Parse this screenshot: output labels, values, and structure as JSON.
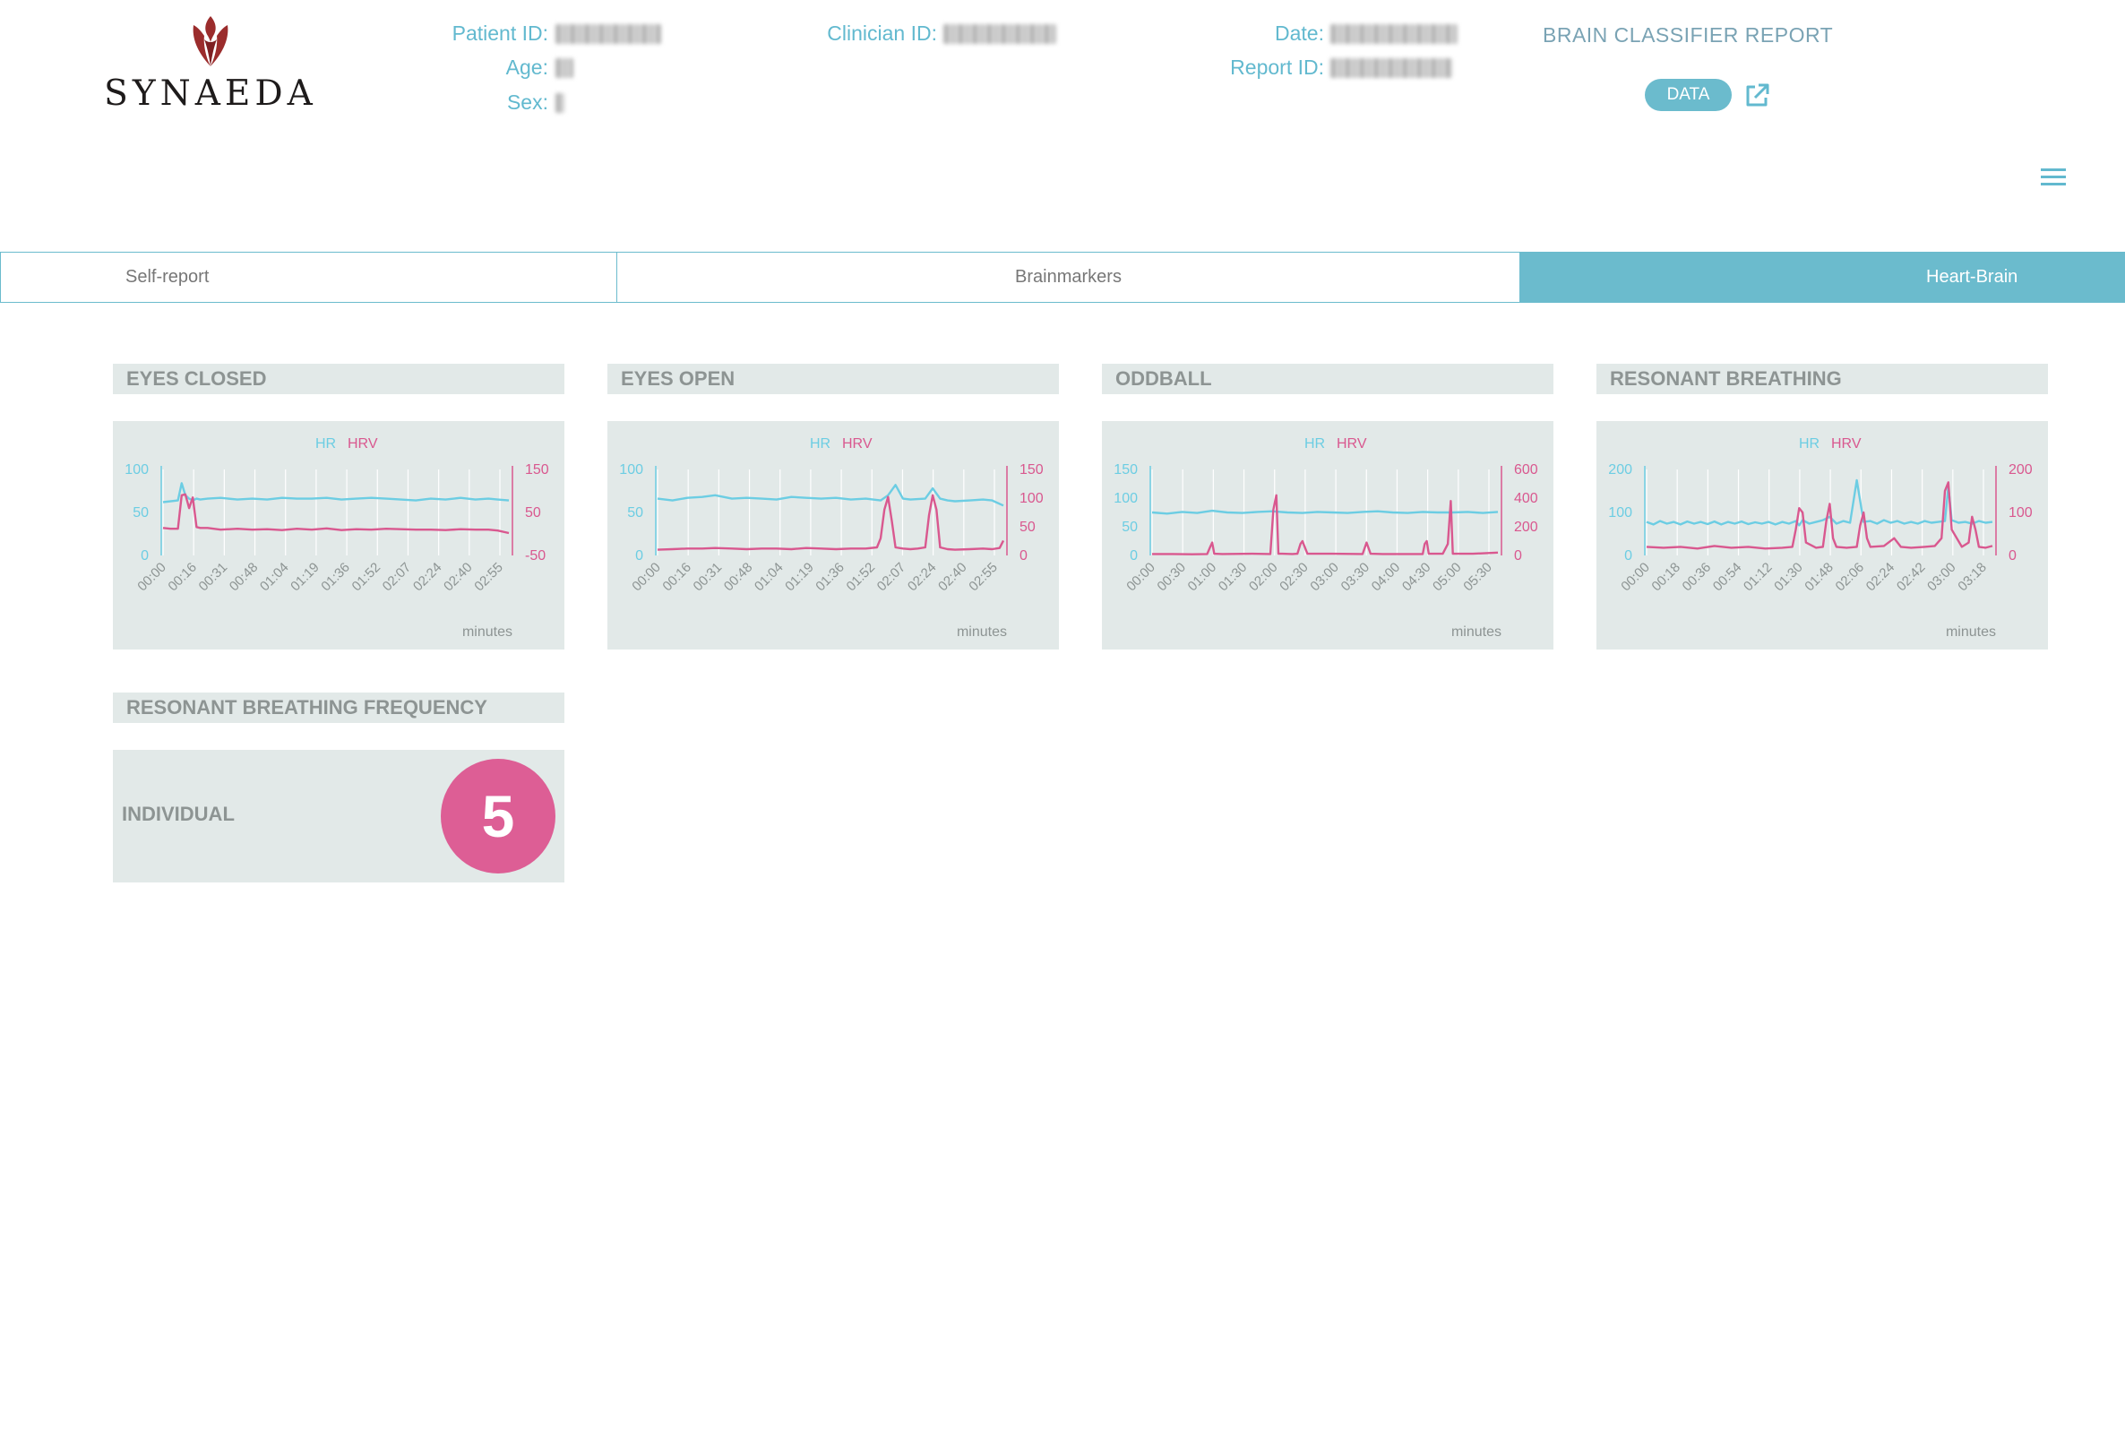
{
  "header": {
    "brand": "SYNAEDA",
    "patient_id_label": "Patient ID:",
    "age_label": "Age:",
    "sex_label": "Sex:",
    "clinician_id_label": "Clinician ID:",
    "date_label": "Date:",
    "report_id_label": "Report ID:",
    "report_title": "BRAIN CLASSIFIER REPORT",
    "data_button": "DATA"
  },
  "icons": {
    "logo": "tulip-icon",
    "external": "external-link-icon",
    "menu": "hamburger-menu-icon"
  },
  "colors": {
    "accent": "#6bbbcd",
    "hr": "#6ccde3",
    "hrv": "#d9588f",
    "panel_bg": "#e2e9e8",
    "frequency_badge": "#dd5e95",
    "brand": "#9b2c2c"
  },
  "tabs": [
    {
      "label": "Self-report",
      "active": false
    },
    {
      "label": "Brainmarkers",
      "active": false
    },
    {
      "label": "Heart-Brain",
      "active": true
    }
  ],
  "panels": [
    {
      "title": "EYES CLOSED"
    },
    {
      "title": "EYES OPEN"
    },
    {
      "title": "ODDBALL"
    },
    {
      "title": "RESONANT BREATHING"
    }
  ],
  "chart_data": [
    {
      "type": "line",
      "title": "EYES CLOSED",
      "xlabel": "minutes",
      "legend": [
        "HR",
        "HRV"
      ],
      "x_ticks": [
        "00:00",
        "00:16",
        "00:31",
        "00:48",
        "01:04",
        "01:19",
        "01:36",
        "01:52",
        "02:07",
        "02:24",
        "02:40",
        "02:55"
      ],
      "y_left_ticks": [
        "100",
        "50",
        "0"
      ],
      "y_right_ticks": [
        "150",
        "50",
        "-50"
      ],
      "y_left_range": [
        0,
        100
      ],
      "y_right_range": [
        -50,
        150
      ],
      "series": [
        {
          "name": "HR",
          "axis": "left",
          "x": [
            0,
            8,
            10,
            12,
            14,
            16,
            18,
            20,
            24,
            31,
            40,
            48,
            56,
            64,
            72,
            80,
            88,
            96,
            104,
            112,
            120,
            128,
            136,
            144,
            152,
            160,
            168,
            175,
            180,
            186
          ],
          "values": [
            62,
            64,
            84,
            70,
            66,
            64,
            66,
            65,
            66,
            67,
            65,
            66,
            65,
            67,
            66,
            66,
            67,
            65,
            66,
            67,
            66,
            65,
            64,
            66,
            65,
            67,
            65,
            66,
            65,
            64
          ]
        },
        {
          "name": "HRV",
          "axis": "right",
          "x": [
            0,
            4,
            8,
            10,
            12,
            14,
            16,
            18,
            20,
            24,
            31,
            40,
            48,
            56,
            64,
            72,
            80,
            88,
            96,
            104,
            112,
            120,
            128,
            136,
            144,
            152,
            160,
            168,
            175,
            180,
            186
          ],
          "values": [
            14,
            12,
            12,
            90,
            92,
            60,
            85,
            16,
            14,
            14,
            10,
            12,
            10,
            11,
            9,
            12,
            10,
            13,
            9,
            11,
            10,
            12,
            11,
            10,
            10,
            9,
            11,
            10,
            10,
            8,
            2
          ]
        }
      ]
    },
    {
      "type": "line",
      "title": "EYES OPEN",
      "xlabel": "minutes",
      "legend": [
        "HR",
        "HRV"
      ],
      "x_ticks": [
        "00:00",
        "00:16",
        "00:31",
        "00:48",
        "01:04",
        "01:19",
        "01:36",
        "01:52",
        "02:07",
        "02:24",
        "02:40",
        "02:55"
      ],
      "y_left_ticks": [
        "100",
        "50",
        "0"
      ],
      "y_right_ticks": [
        "150",
        "100",
        "50",
        "0"
      ],
      "y_left_range": [
        0,
        100
      ],
      "y_right_range": [
        0,
        150
      ],
      "series": [
        {
          "name": "HR",
          "axis": "left",
          "x": [
            0,
            8,
            16,
            24,
            31,
            40,
            48,
            56,
            64,
            72,
            80,
            88,
            96,
            104,
            112,
            120,
            124,
            128,
            132,
            136,
            144,
            148,
            152,
            156,
            160,
            168,
            175,
            180,
            186
          ],
          "values": [
            66,
            64,
            67,
            68,
            70,
            66,
            67,
            66,
            65,
            68,
            67,
            66,
            67,
            65,
            66,
            64,
            70,
            82,
            66,
            65,
            66,
            78,
            66,
            64,
            63,
            64,
            65,
            64,
            58
          ]
        },
        {
          "name": "HRV",
          "axis": "left_scaled",
          "axis_note": "right",
          "x": [
            0,
            8,
            16,
            24,
            31,
            40,
            48,
            56,
            64,
            72,
            80,
            88,
            96,
            104,
            112,
            118,
            120,
            122,
            124,
            126,
            128,
            132,
            136,
            140,
            144,
            146,
            148,
            150,
            152,
            156,
            160,
            168,
            175,
            180,
            184,
            186
          ],
          "values": [
            10,
            11,
            12,
            12,
            13,
            12,
            11,
            12,
            12,
            11,
            13,
            12,
            11,
            12,
            12,
            14,
            30,
            80,
            102,
            60,
            14,
            12,
            11,
            12,
            14,
            70,
            105,
            80,
            14,
            11,
            10,
            11,
            12,
            11,
            13,
            26
          ]
        }
      ]
    },
    {
      "type": "line",
      "title": "ODDBALL",
      "xlabel": "minutes",
      "legend": [
        "HR",
        "HRV"
      ],
      "x_ticks": [
        "00:00",
        "00:30",
        "01:00",
        "01:30",
        "02:00",
        "02:30",
        "03:00",
        "03:30",
        "04:00",
        "04:30",
        "05:00",
        "05:30"
      ],
      "y_left_ticks": [
        "150",
        "100",
        "50",
        "0"
      ],
      "y_right_ticks": [
        "600",
        "400",
        "200",
        "0"
      ],
      "y_left_range": [
        0,
        150
      ],
      "y_right_range": [
        0,
        600
      ],
      "series": [
        {
          "name": "HR",
          "axis": "left",
          "x": [
            0,
            15,
            30,
            45,
            60,
            75,
            90,
            105,
            120,
            135,
            150,
            165,
            180,
            195,
            210,
            225,
            240,
            255,
            270,
            285,
            300,
            315,
            330,
            345
          ],
          "values": [
            75,
            73,
            76,
            74,
            78,
            75,
            74,
            76,
            77,
            75,
            74,
            76,
            75,
            74,
            76,
            77,
            75,
            74,
            76,
            75,
            75,
            76,
            74,
            76
          ]
        },
        {
          "name": "HRV",
          "axis": "right",
          "x": [
            0,
            20,
            40,
            55,
            58,
            60,
            62,
            70,
            100,
            118,
            121,
            124,
            126,
            130,
            140,
            145,
            148,
            150,
            155,
            180,
            210,
            210,
            214,
            218,
            230,
            260,
            270,
            272,
            274,
            276,
            280,
            290,
            295,
            298,
            300,
            304,
            320,
            345
          ],
          "values": [
            10,
            10,
            8,
            10,
            60,
            90,
            12,
            10,
            12,
            10,
            320,
            420,
            12,
            12,
            10,
            12,
            80,
            100,
            12,
            12,
            10,
            10,
            90,
            12,
            10,
            10,
            10,
            80,
            100,
            12,
            12,
            12,
            80,
            380,
            12,
            12,
            12,
            20
          ]
        }
      ]
    },
    {
      "type": "line",
      "title": "RESONANT BREATHING",
      "xlabel": "minutes",
      "legend": [
        "HR",
        "HRV"
      ],
      "x_ticks": [
        "00:00",
        "00:18",
        "00:36",
        "00:54",
        "01:12",
        "01:30",
        "01:48",
        "02:06",
        "02:24",
        "02:42",
        "03:00",
        "03:18"
      ],
      "y_left_ticks": [
        "200",
        "100",
        "0"
      ],
      "y_right_ticks": [
        "200",
        "100",
        "0"
      ],
      "y_left_range": [
        0,
        200
      ],
      "y_right_range": [
        0,
        200
      ],
      "series": [
        {
          "name": "HR",
          "axis": "left",
          "x": [
            0,
            4,
            8,
            12,
            16,
            20,
            24,
            28,
            32,
            36,
            40,
            44,
            48,
            52,
            56,
            60,
            64,
            68,
            72,
            76,
            80,
            84,
            88,
            90,
            92,
            96,
            100,
            104,
            108,
            112,
            116,
            120,
            124,
            128,
            132,
            136,
            140,
            144,
            148,
            152,
            156,
            160,
            164,
            168,
            172,
            176,
            178,
            180,
            184,
            188,
            192,
            196,
            200,
            204
          ],
          "values": [
            78,
            72,
            80,
            74,
            78,
            72,
            79,
            74,
            78,
            73,
            79,
            72,
            78,
            74,
            79,
            73,
            77,
            74,
            78,
            72,
            78,
            74,
            80,
            70,
            82,
            74,
            78,
            82,
            90,
            74,
            80,
            76,
            175,
            78,
            80,
            74,
            82,
            76,
            80,
            74,
            78,
            74,
            80,
            76,
            78,
            80,
            160,
            82,
            76,
            78,
            74,
            80,
            76,
            78
          ]
        },
        {
          "name": "HRV",
          "axis": "right",
          "x": [
            0,
            10,
            20,
            30,
            40,
            50,
            60,
            70,
            80,
            86,
            88,
            90,
            92,
            94,
            100,
            104,
            106,
            108,
            110,
            112,
            118,
            124,
            126,
            128,
            130,
            132,
            140,
            146,
            150,
            156,
            164,
            170,
            174,
            176,
            178,
            180,
            186,
            190,
            192,
            194,
            196,
            200,
            204
          ],
          "values": [
            20,
            18,
            20,
            16,
            22,
            18,
            20,
            16,
            18,
            20,
            60,
            110,
            100,
            30,
            18,
            20,
            80,
            120,
            40,
            20,
            18,
            20,
            70,
            100,
            40,
            20,
            22,
            40,
            20,
            18,
            20,
            22,
            40,
            150,
            170,
            60,
            20,
            30,
            90,
            60,
            20,
            18,
            22
          ]
        }
      ]
    }
  ],
  "frequency": {
    "title": "RESONANT BREATHING FREQUENCY",
    "label": "INDIVIDUAL",
    "value": "5"
  }
}
